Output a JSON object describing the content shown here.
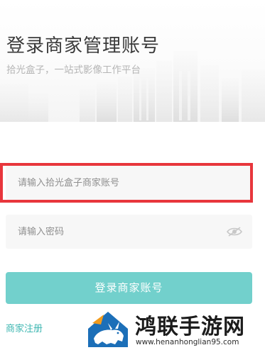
{
  "header": {
    "title": "登录商家管理账号",
    "subtitle": "拾光盒子，一站式影像工作平台"
  },
  "form": {
    "account_placeholder": "请输入拾光盒子商家账号",
    "password_placeholder": "请输入密码",
    "submit_label": "登录商家账号",
    "register_link": "商家注册"
  },
  "watermark": {
    "name": "鸿联手游网",
    "url": "www.henanhonglian95.com"
  },
  "colors": {
    "accent": "#72d0cc",
    "link": "#3fb7b2",
    "highlight": "#e8363c",
    "field_bg": "#f7f7f7"
  },
  "icons": {
    "password_toggle": "eye-hidden-icon",
    "watermark_logo": "bull-logo-icon"
  }
}
